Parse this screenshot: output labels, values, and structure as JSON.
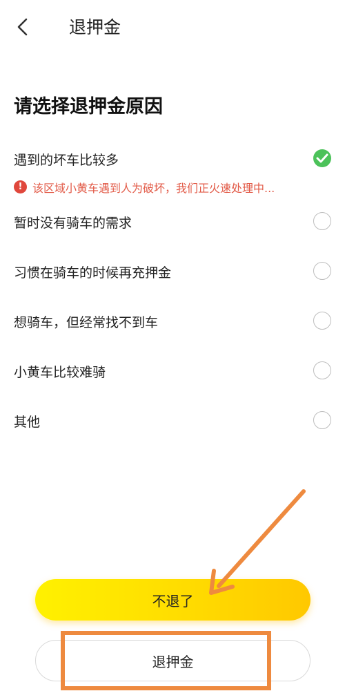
{
  "header": {
    "title": "退押金",
    "back_icon": "chevron-left-icon"
  },
  "section_title": "请选择退押金原因",
  "reasons": [
    {
      "label": "遇到的坏车比较多",
      "selected": true
    },
    {
      "label": "暂时没有骑车的需求",
      "selected": false
    },
    {
      "label": "习惯在骑车的时候再充押金",
      "selected": false
    },
    {
      "label": "想骑车，但经常找不到车",
      "selected": false
    },
    {
      "label": "小黄车比较难骑",
      "selected": false
    },
    {
      "label": "其他",
      "selected": false
    }
  ],
  "warning": {
    "icon": "!",
    "text": "该区域小黄车遇到人为破坏，我们正火速处理中..."
  },
  "buttons": {
    "primary_label": "不退了",
    "secondary_label": "退押金"
  },
  "colors": {
    "accent_yellow": "#ffdc00",
    "check_green": "#4cc25a",
    "warning_red": "#e25a47",
    "annotation_orange": "#ee8a3f"
  }
}
